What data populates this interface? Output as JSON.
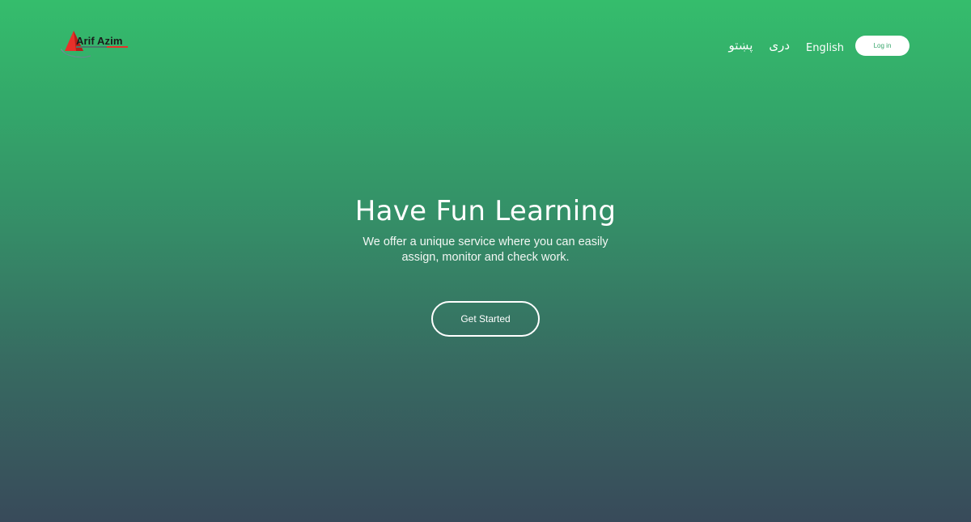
{
  "header": {
    "logo": {
      "text": "Arif Azim",
      "icon": "triangle-swoosh-logo",
      "colors": {
        "triangle": "#e8302a",
        "swoosh": "#8ea0b0",
        "text": "#1b1b1b"
      }
    },
    "nav": {
      "languages": [
        {
          "label": "پښتو"
        },
        {
          "label": "دری"
        },
        {
          "label": "English"
        }
      ],
      "login_label": "Log in"
    }
  },
  "hero": {
    "title": "Have Fun Learning",
    "subtitle": "We offer a unique service where you can easily assign, monitor and check work.",
    "cta_label": "Get Started"
  },
  "theme": {
    "gradient_top": "#35bd6c",
    "gradient_bottom": "#384a5a",
    "login_text_color": "#35a56a"
  }
}
